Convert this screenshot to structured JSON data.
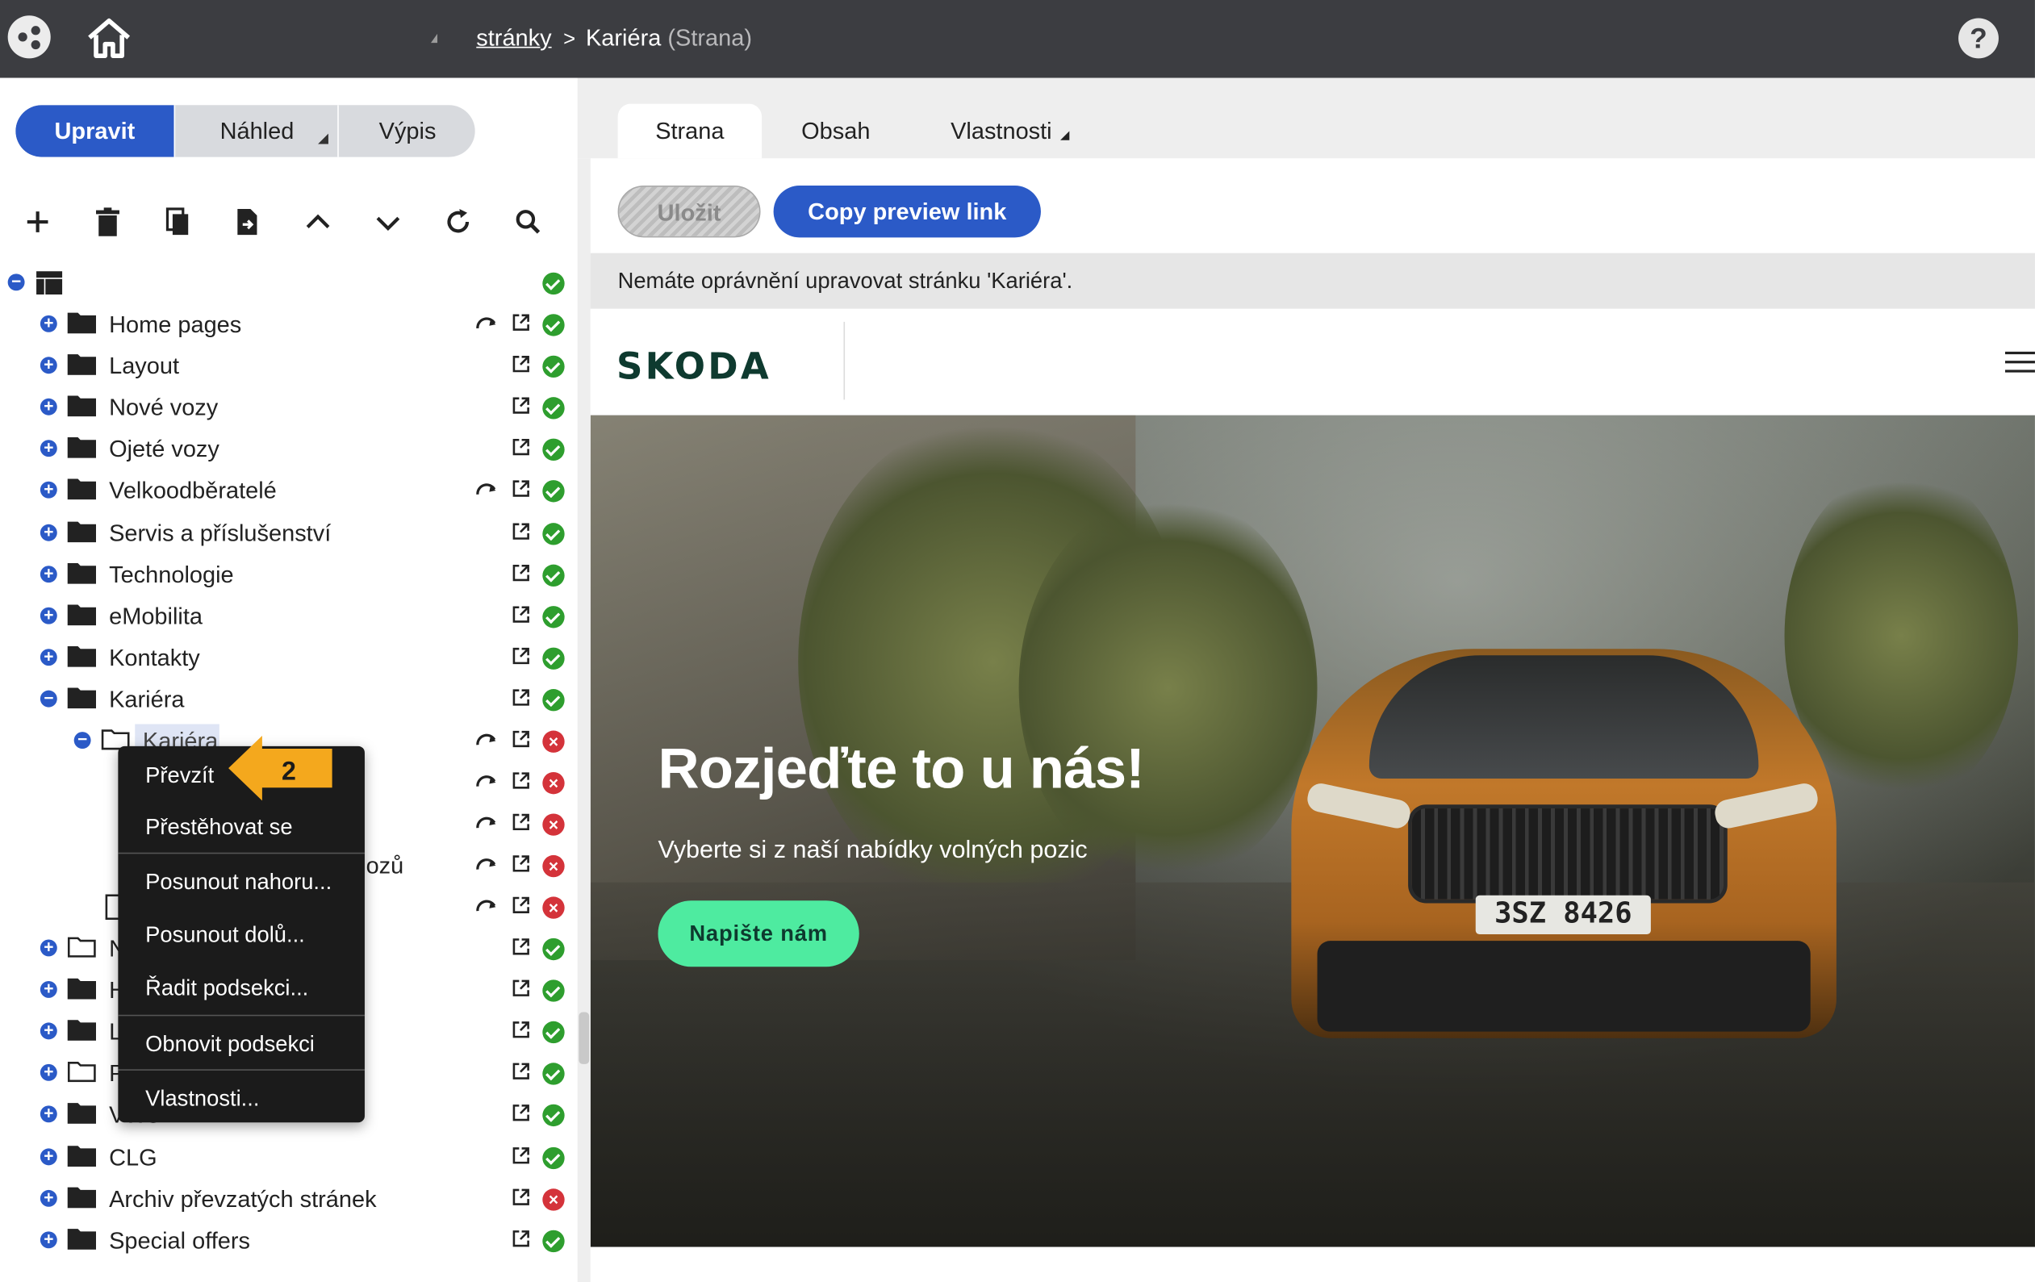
{
  "topbar": {
    "breadcrumb": {
      "root_link": "stránky",
      "separator": ">",
      "current": "Kariéra",
      "type": "(Strana)"
    },
    "help_label": "?"
  },
  "mode": {
    "edit": "Upravit",
    "preview": "Náhled",
    "list": "Výpis"
  },
  "toolbar": {
    "icons": [
      "plus-icon",
      "trash-icon",
      "copy-icon",
      "export-icon",
      "chevron-up-icon",
      "chevron-down-icon",
      "refresh-icon",
      "search-icon"
    ]
  },
  "tree": {
    "items": [
      {
        "label": "Home pages",
        "redirect": true,
        "status": "ok"
      },
      {
        "label": "Layout",
        "redirect": false,
        "status": "ok"
      },
      {
        "label": "Nové vozy",
        "redirect": false,
        "status": "ok"
      },
      {
        "label": "Ojeté vozy",
        "redirect": false,
        "status": "ok"
      },
      {
        "label": "Velkoodběratelé",
        "redirect": true,
        "status": "ok"
      },
      {
        "label": "Servis a příslušenství",
        "redirect": false,
        "status": "ok"
      },
      {
        "label": "Technologie",
        "redirect": false,
        "status": "ok"
      },
      {
        "label": "eMobilita",
        "redirect": false,
        "status": "ok"
      },
      {
        "label": "Kontakty",
        "redirect": false,
        "status": "ok"
      },
      {
        "label": "Kariéra",
        "redirect": false,
        "status": "ok"
      }
    ],
    "child_selected": "Kariéra",
    "partial_label": "ozů",
    "partial_letters": [
      "N",
      "H",
      "L",
      "P",
      "VW3"
    ],
    "bottom_items": [
      {
        "label": "CLG",
        "status": "ok"
      },
      {
        "label": "Archiv převzatých stránek",
        "status": "error"
      },
      {
        "label": "Special offers",
        "status": "ok"
      }
    ]
  },
  "context_menu": {
    "items": [
      "Převzít",
      "Přestěhovat se",
      "Posunout nahoru...",
      "Posunout dolů...",
      "Řadit podsekci...",
      "Obnovit podsekci",
      "Vlastnosti..."
    ],
    "callout_number": "2",
    "callout_color": "#f4a81d"
  },
  "tabs": {
    "page": "Strana",
    "content": "Obsah",
    "properties": "Vlastnosti"
  },
  "actions": {
    "save": "Uložit",
    "copy_preview": "Copy preview link"
  },
  "notice": "Nemáte oprávnění upravovat stránku 'Kariéra'.",
  "preview": {
    "logo": "SKODA",
    "hero_title": "Rozjeďte to u nás!",
    "hero_subtitle": "Vyberte si z naší nabídky volných pozic",
    "cta": "Napište nám",
    "plate": "3SZ 8426"
  },
  "colors": {
    "topbar": "#3c3d41",
    "accent": "#2b5ac7",
    "ok": "#2e9e2e",
    "error": "#d4333a",
    "cta": "#4eeba0",
    "skoda_green": "#0e3a2f"
  }
}
